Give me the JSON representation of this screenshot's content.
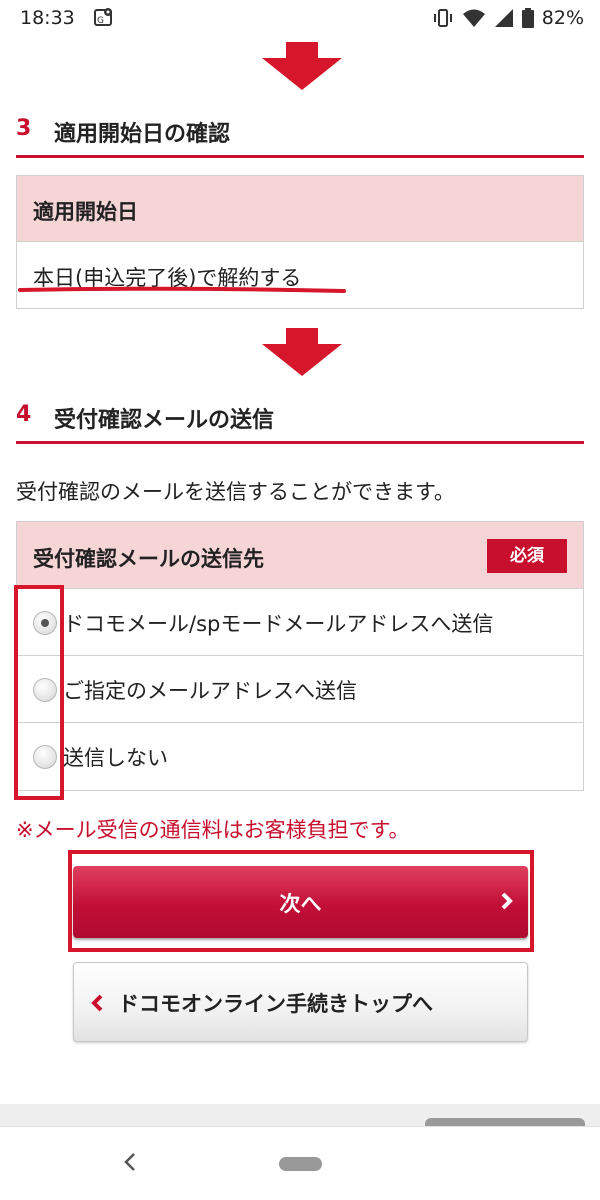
{
  "status_bar": {
    "time": "18:33",
    "battery_percent": "82%",
    "icons": [
      "maps-icon",
      "vibrate-icon",
      "wifi-icon",
      "signal-icon",
      "battery-icon"
    ]
  },
  "section3": {
    "number": "3",
    "title": "適用開始日の確認",
    "box_header": "適用開始日",
    "box_value": "本日(申込完了後)で解約する"
  },
  "section4": {
    "number": "4",
    "title": "受付確認メールの送信",
    "description": "受付確認のメールを送信することができます。",
    "box_header": "受付確認メールの送信先",
    "required_badge": "必須",
    "options": [
      {
        "label": "ドコモメール/spモードメールアドレスへ送信",
        "checked": true
      },
      {
        "label": "ご指定のメールアドレスへ送信",
        "checked": false
      },
      {
        "label": "送信しない",
        "checked": false
      }
    ],
    "notice": "※メール受信の通信料はお客様負担です。"
  },
  "buttons": {
    "next_label": "次へ",
    "top_label": "ドコモオンライン手続きトップへ"
  },
  "colors": {
    "accent": "#c8102e",
    "header_bg": "#f6d5d7",
    "annotation_red": "#d5162b"
  }
}
